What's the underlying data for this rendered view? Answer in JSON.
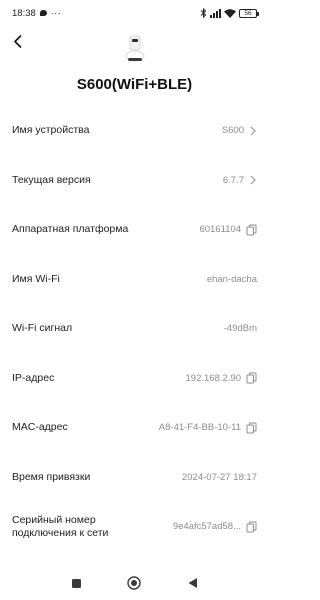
{
  "status_bar": {
    "time": "18:38",
    "notification_dots": "···",
    "battery": "56"
  },
  "header": {
    "device_name": "S600(WiFi+BLE)"
  },
  "rows": [
    {
      "label": "Имя устройства",
      "value": "S600",
      "trailing": "chevron"
    },
    {
      "label": "Текущая версия",
      "value": "6.7.7",
      "trailing": "chevron"
    },
    {
      "label": "Аппаратная платформа",
      "value": "60161104",
      "trailing": "copy"
    },
    {
      "label": "Имя Wi-Fi",
      "value": "ehan-dacha",
      "trailing": "none"
    },
    {
      "label": "Wi-Fi сигнал",
      "value": "-49dBm",
      "trailing": "none"
    },
    {
      "label": "IP-адрес",
      "value": "192.168.2.90",
      "trailing": "copy"
    },
    {
      "label": "MAC-адрес",
      "value": "A8-41-F4-BB-10-11",
      "trailing": "copy"
    },
    {
      "label": "Время привязки",
      "value": "2024-07-27 18:17",
      "trailing": "none"
    },
    {
      "label": "Серийный номер подключения к сети",
      "value": "9e4afc57ad58...",
      "trailing": "copy"
    }
  ],
  "colors": {
    "background": "#ffffff",
    "label": "#222222",
    "value": "#8c8c8c"
  },
  "nav": {
    "icons": [
      "square-icon",
      "home-circle-icon",
      "back-triangle-icon"
    ]
  }
}
